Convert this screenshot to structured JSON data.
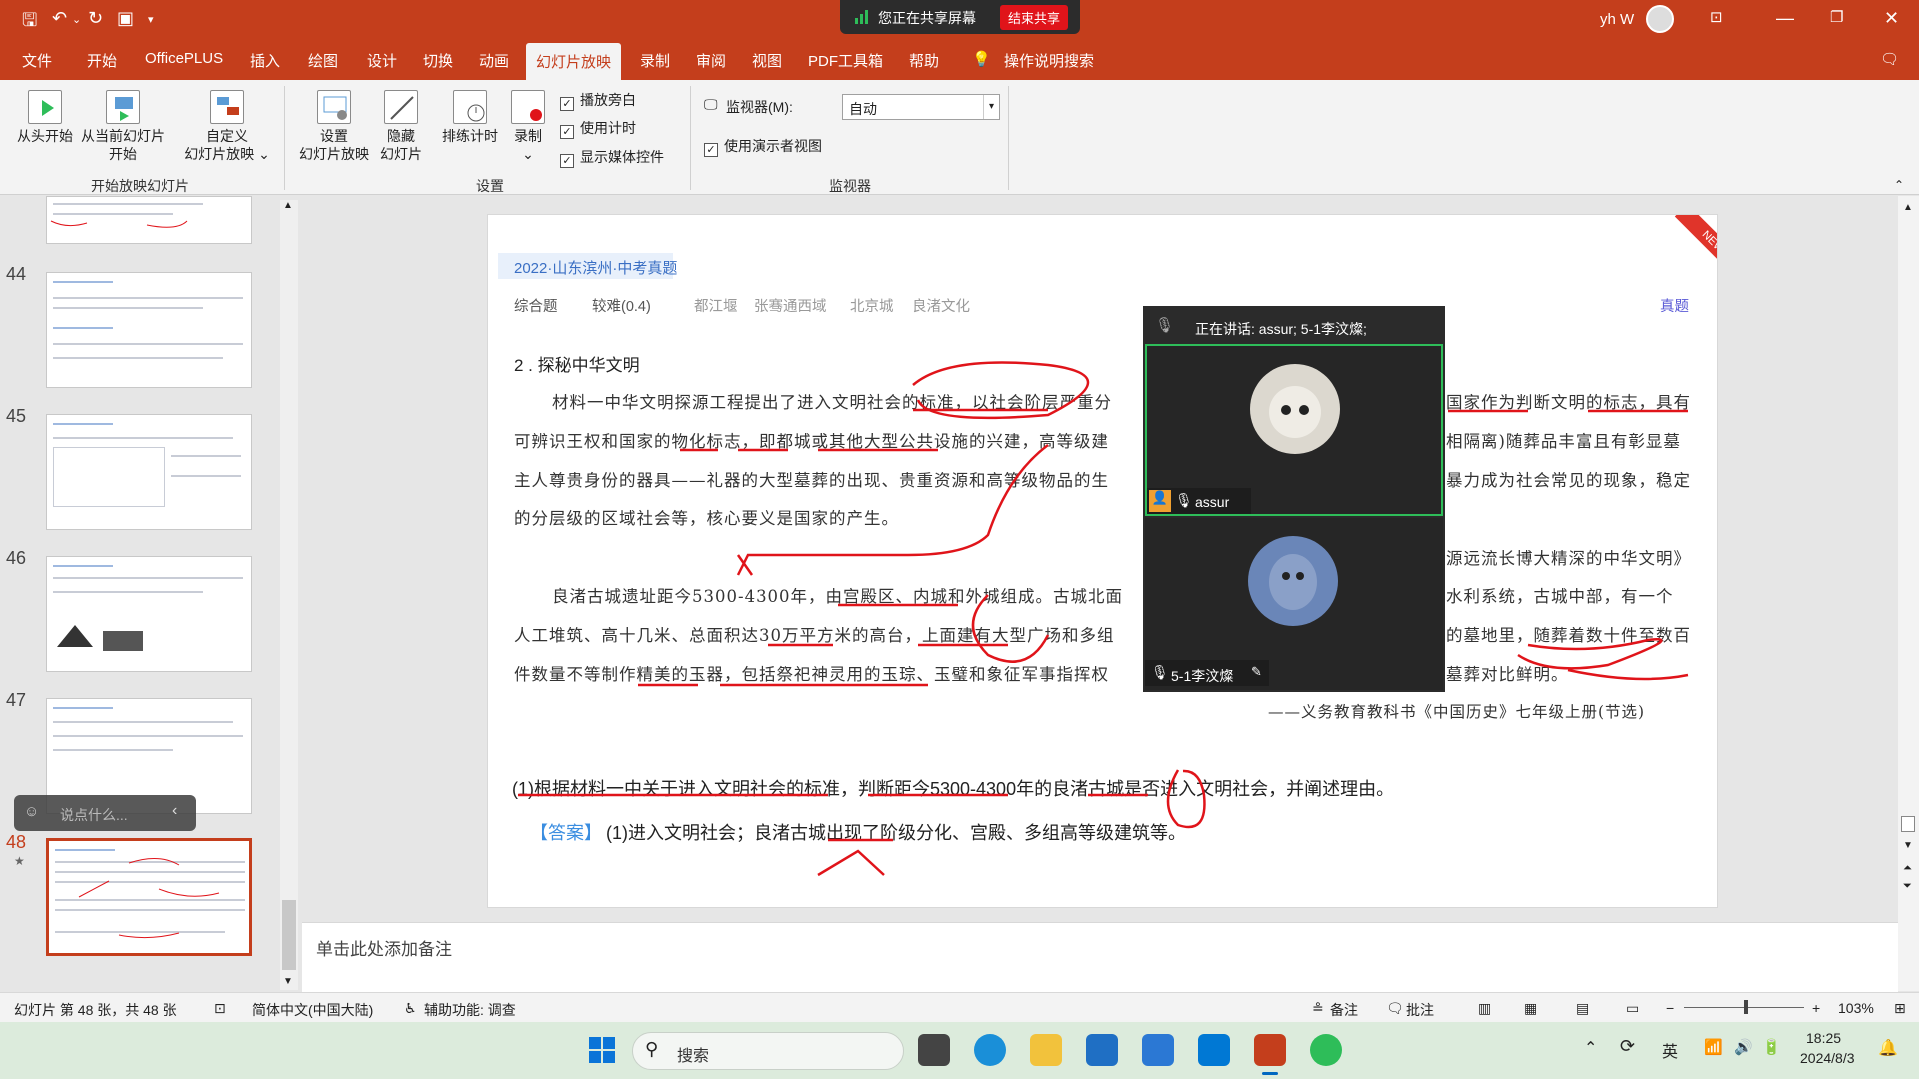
{
  "title_bar": {
    "user_name": "yh W",
    "share_status": "您正在共享屏幕",
    "stop_share_label": "结束共享"
  },
  "tabs": [
    "文件",
    "开始",
    "OfficePLUS",
    "插入",
    "绘图",
    "设计",
    "切换",
    "动画",
    "幻灯片放映",
    "录制",
    "审阅",
    "视图",
    "PDF工具箱",
    "帮助"
  ],
  "active_tab": "幻灯片放映",
  "tell_me": "操作说明搜索",
  "ribbon": {
    "from_start": "从头开始",
    "from_current_1": "从当前幻灯片",
    "from_current_2": "开始",
    "custom_1": "自定义",
    "custom_2": "幻灯片放映",
    "group_start": "开始放映幻灯片",
    "setup_1": "设置",
    "setup_2": "幻灯片放映",
    "hide_1": "隐藏",
    "hide_2": "幻灯片",
    "rehearse": "排练计时",
    "record": "录制",
    "play_narration": "播放旁白",
    "use_timings": "使用计时",
    "show_media": "显示媒体控件",
    "group_setup": "设置",
    "monitor_label": "监视器(M):",
    "monitor_value": "自动",
    "presenter_view": "使用演示者视图",
    "group_monitor": "监视器"
  },
  "thumbnails": [
    {
      "num": "44"
    },
    {
      "num": "45"
    },
    {
      "num": "46"
    },
    {
      "num": "47"
    },
    {
      "num": "48"
    }
  ],
  "chat_placeholder": "说点什么...",
  "slide": {
    "tag": "2022·山东滨州·中考真题",
    "corner": "NEW",
    "meta": [
      "综合题",
      "较难(0.4)",
      "都江堰",
      "张骞通西域",
      "北京城",
      "良渚文化"
    ],
    "meta_right": "真题",
    "question_title": "2 . 探秘中华文明",
    "p1_l1a": "材料一中华文明探源工程提出了进入文明社会的标准，以社会阶层严重分",
    "p1_l1b": "国家作为判断文明的标志，具有",
    "p1_l2a": "可辨识王权和国家的物化标志，即都城或其他大型公共设施的兴建，高等级建",
    "p1_l2b": "相隔离)随葬品丰富且有彰显墓",
    "p1_l3a": "主人尊贵身份的器具——礼器的大型墓葬的出现、贵重资源和高等级物品的生",
    "p1_l3b": "暴力成为社会常见的现象，稳定",
    "p1_l4": "的分层级的区域社会等，核心要义是国家的产生。",
    "p1_src": "源远流长博大精深的中华文明》",
    "p2_l1a": "良渚古城遗址距今5300-4300年，由宫殿区、内城和外城组成。古城北面",
    "p2_l1b": "水利系统，古城中部，有一个",
    "p2_l2a": "人工堆筑、高十几米、总面积达30万平方米的高台，上面建有大型广场和多组",
    "p2_l2b": "的墓地里，随葬着数十件至数百",
    "p2_l3a": "件数量不等制作精美的玉器，包括祭祀神灵用的玉琮、玉璧和象征军事指挥权",
    "p2_l3b": "墓葬对比鲜明。",
    "p2_src": "——义务教育教科书《中国历史》七年级上册(节选)",
    "q1": "(1)根据材料一中关于进入文明社会的标准，判断距今5300-4300年的良渚古城是否进入文明社会，并阐述理由。",
    "answer_tag": "【答案】",
    "answer": "(1)进入文明社会；良渚古城出现了阶级分化、宫殿、多组高等级建筑等。"
  },
  "meeting": {
    "speaking": "正在讲话:  assur; 5-1李汶燦;",
    "p1_name": "assur",
    "p2_name": "5-1李汶燦"
  },
  "notes_placeholder": "单击此处添加备注",
  "status": {
    "slide_info": "幻灯片 第 48 张，共 48 张",
    "language": "简体中文(中国大陆)",
    "accessibility": "辅助功能: 调查",
    "notes": "备注",
    "comments": "批注",
    "zoom": "103%"
  },
  "taskbar": {
    "search": "搜索",
    "ime": "英",
    "time": "18:25",
    "date": "2024/8/3"
  },
  "colors": {
    "accent": "#c43e1c",
    "ink": "#e0141a",
    "meet_green": "#2ebd59"
  }
}
